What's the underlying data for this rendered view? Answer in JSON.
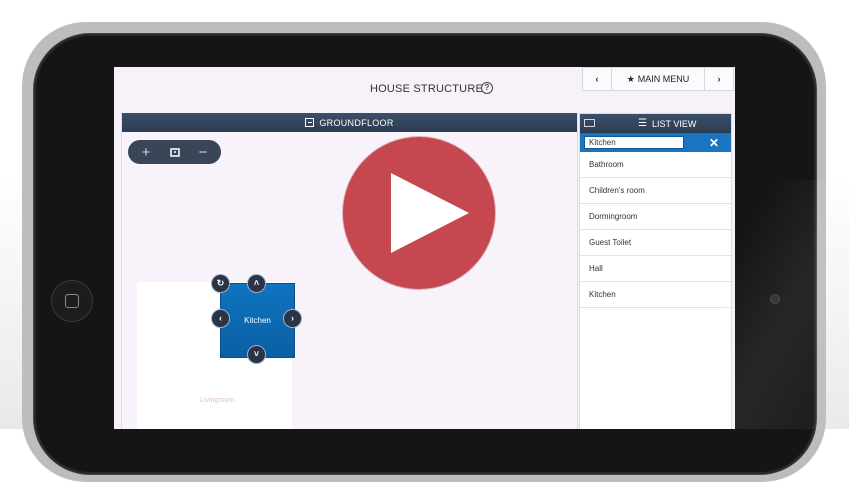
{
  "page": {
    "title": "HOUSE STRUCTURE",
    "help_icon": "question-circle-icon"
  },
  "topnav": {
    "prev": "‹",
    "main_menu": "MAIN MENU",
    "main_menu_icon": "star-icon",
    "next": "›"
  },
  "floor_panel": {
    "title": "GROUNDFLOOR",
    "icon": "floorplan-icon",
    "zoom": {
      "zoom_in": "+",
      "zoom_out": "−"
    }
  },
  "rooms": {
    "kitchen": "Kitchen",
    "livingroom": "Livingroom"
  },
  "room_controls": {
    "rotate": "↻",
    "up": "˄",
    "left": "‹",
    "right": "›",
    "down": "˅"
  },
  "list_panel": {
    "title": "LIST VIEW",
    "search_value": "Kitchen",
    "clear": "✕",
    "items": [
      "Bathroom",
      "Children's room",
      "Dormingroom",
      "Guest Toilet",
      "Hall",
      "Kitchen"
    ]
  },
  "colors": {
    "accent_blue": "#1a74bf",
    "header_navy": "#34455e",
    "play_red": "#c5474f"
  }
}
